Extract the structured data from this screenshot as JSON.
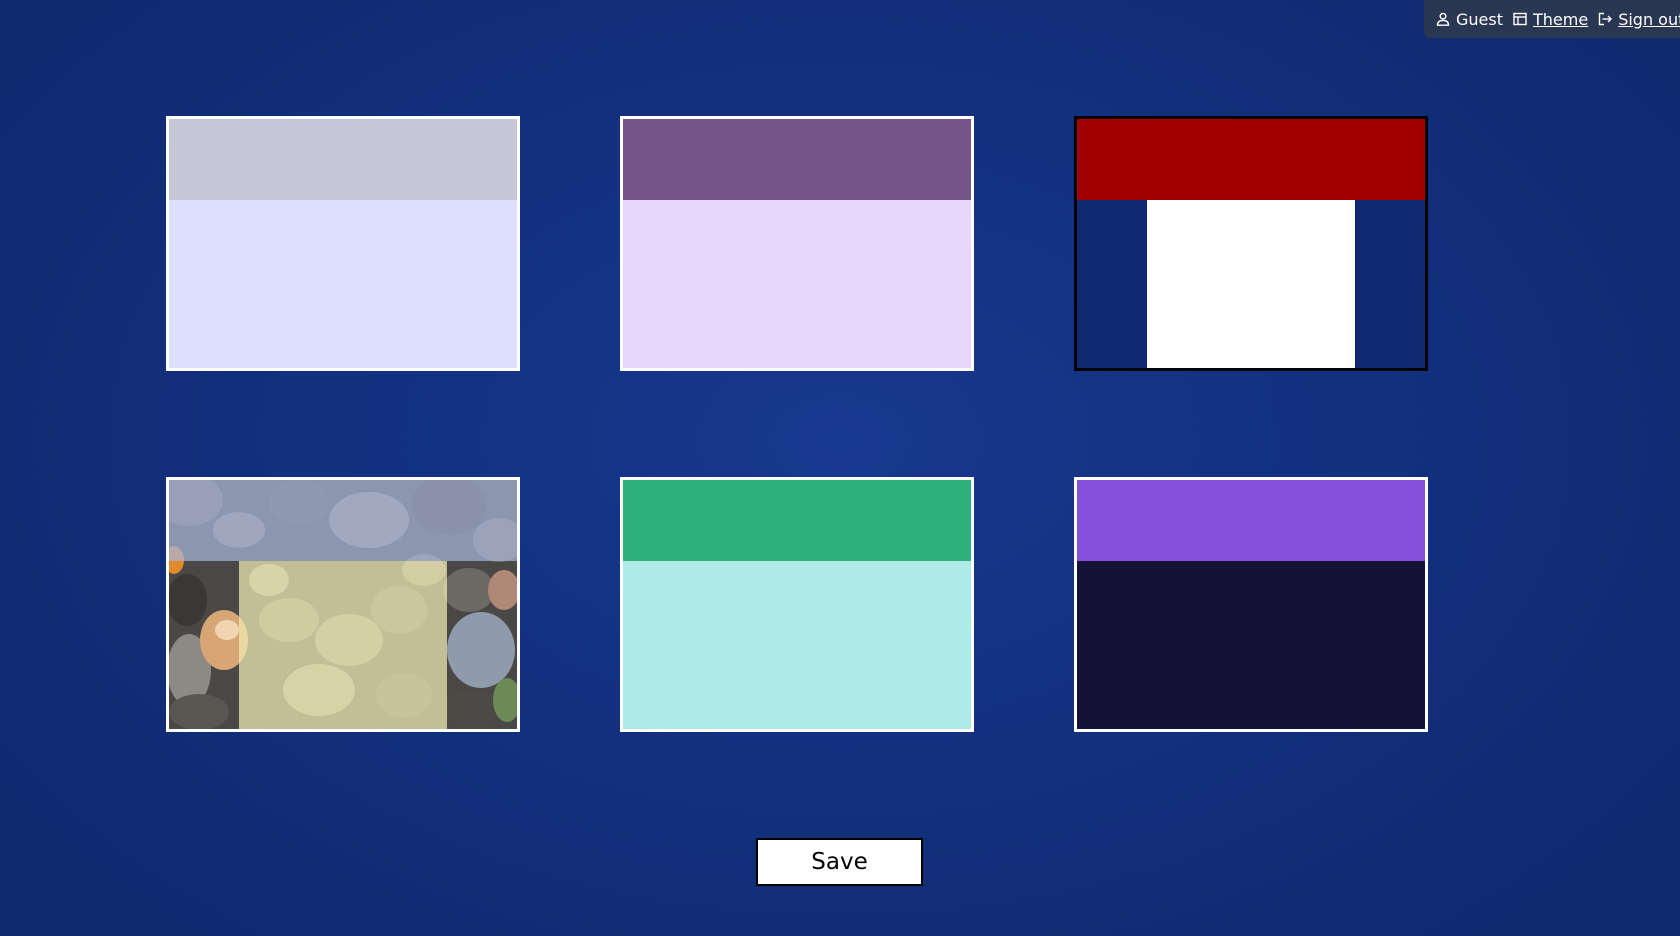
{
  "userbar": {
    "user_label": "Guest",
    "theme_label": "Theme",
    "signout_label": "Sign out",
    "icons": [
      "user-icon",
      "layout-icon",
      "sign-out-icon"
    ]
  },
  "themes": [
    {
      "header_color": "#c5c7d6",
      "body_color": "#dedffe",
      "selected": false
    },
    {
      "header_color": "#75548a",
      "body_color": "#e8d6fc",
      "selected": false
    },
    {
      "header_color": "#a30000",
      "body_color": "#0f2a70",
      "panel_color": "#ffffff",
      "selected": true
    },
    {
      "header_color": "#a8b4d8",
      "body_color": "image:pebbles",
      "panel_color": "#f1ecb4",
      "selected": false
    },
    {
      "header_color": "#2db27c",
      "body_color": "#aeeae8",
      "selected": false
    },
    {
      "header_color": "#8450dd",
      "body_color": "#151238",
      "selected": false
    }
  ],
  "actions": {
    "save_label": "Save"
  }
}
